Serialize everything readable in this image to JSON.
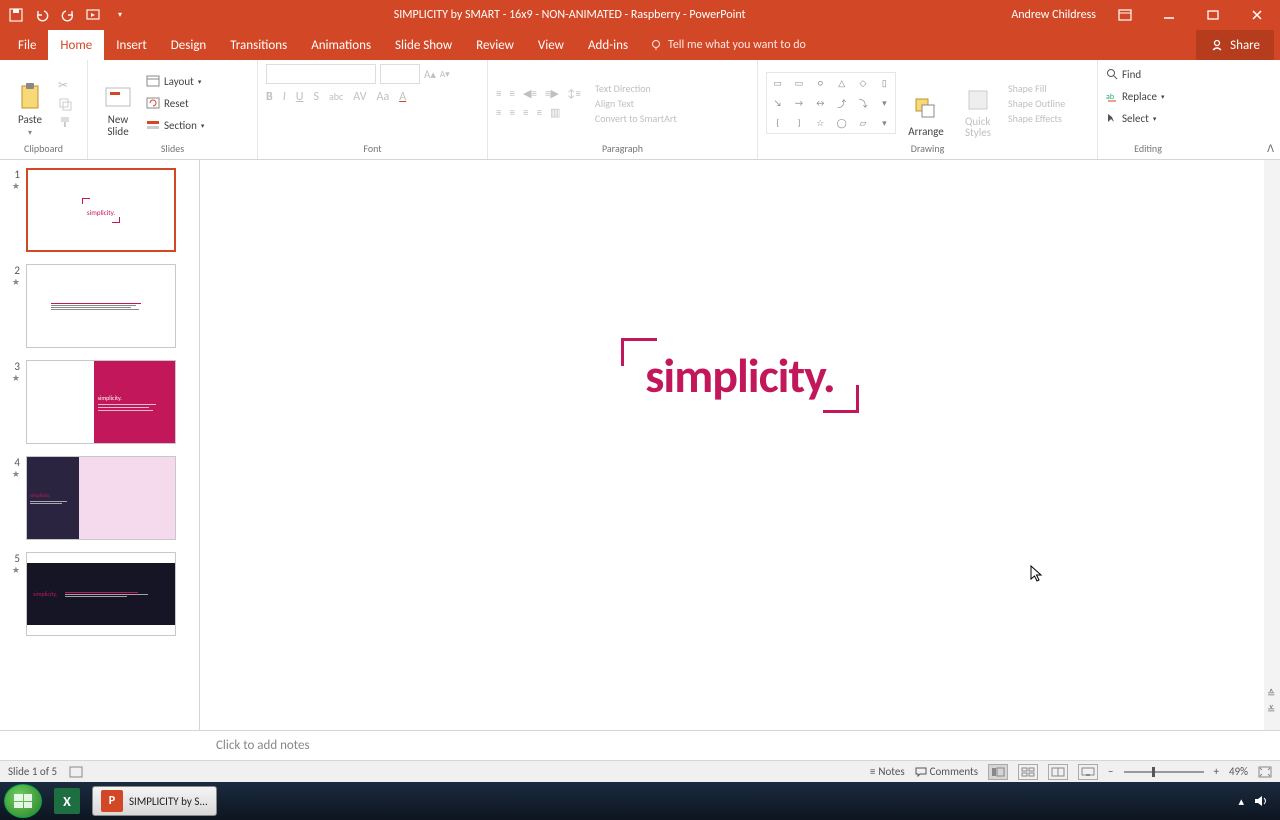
{
  "titlebar": {
    "title": "SIMPLICITY by SMART - 16x9 - NON-ANIMATED - Raspberry - PowerPoint",
    "user": "Andrew Childress"
  },
  "tabs": {
    "file": "File",
    "home": "Home",
    "insert": "Insert",
    "design": "Design",
    "transitions": "Transitions",
    "animations": "Animations",
    "slideshow": "Slide Show",
    "review": "Review",
    "view": "View",
    "addins": "Add-ins",
    "tellme": "Tell me what you want to do",
    "share": "Share"
  },
  "ribbon": {
    "clipboard": {
      "label": "Clipboard",
      "paste": "Paste"
    },
    "slides": {
      "label": "Slides",
      "new_slide": "New\nSlide",
      "layout": "Layout",
      "reset": "Reset",
      "section": "Section"
    },
    "font": {
      "label": "Font"
    },
    "paragraph": {
      "label": "Paragraph",
      "text_direction": "Text Direction",
      "align_text": "Align Text",
      "convert_smartart": "Convert to SmartArt"
    },
    "drawing": {
      "label": "Drawing",
      "arrange": "Arrange",
      "quick_styles": "Quick\nStyles",
      "shape_fill": "Shape Fill",
      "shape_outline": "Shape Outline",
      "shape_effects": "Shape Effects"
    },
    "editing": {
      "label": "Editing",
      "find": "Find",
      "replace": "Replace",
      "select": "Select"
    }
  },
  "thumbs": [
    {
      "num": "1"
    },
    {
      "num": "2"
    },
    {
      "num": "3"
    },
    {
      "num": "4"
    },
    {
      "num": "5"
    }
  ],
  "slide": {
    "main_text": "simplicity."
  },
  "notes": {
    "placeholder": "Click to add notes"
  },
  "status": {
    "slide_info": "Slide 1 of 5",
    "notes": "Notes",
    "comments": "Comments",
    "zoom": "49%"
  },
  "taskbar": {
    "ppt_task": "SIMPLICITY by S..."
  }
}
